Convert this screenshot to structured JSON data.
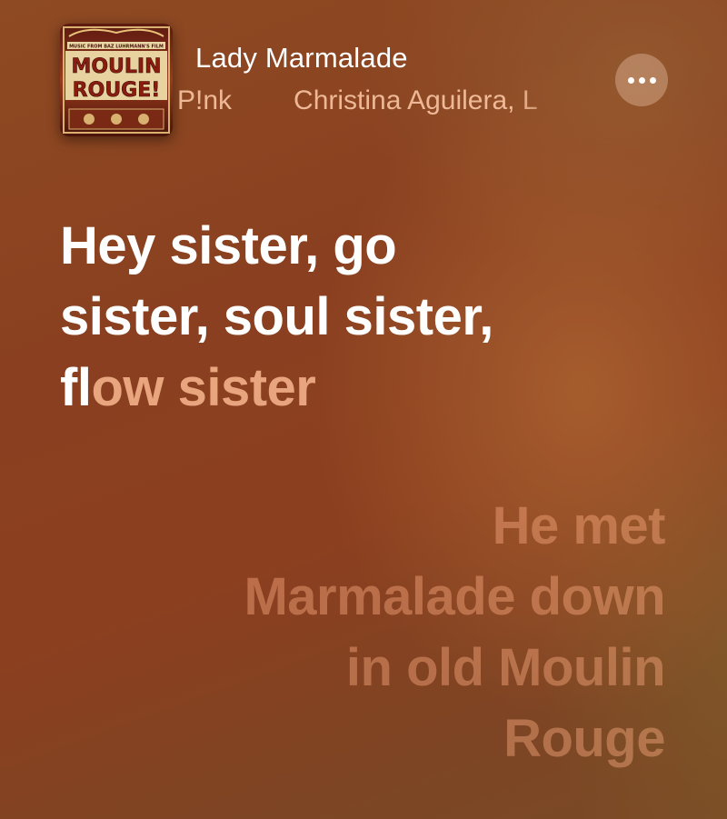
{
  "now_playing": {
    "title": "Lady Marmalade",
    "artists": [
      "P!nk",
      "Christina Aguilera, L"
    ],
    "album_art": {
      "label": "MUSIC FROM BAZ LUHRMANN'S FILM",
      "line1": "MOULIN",
      "line2": "ROUGE!"
    },
    "more_icon": "ellipsis-icon"
  },
  "lyrics": {
    "active": {
      "line1": "Hey sister, go",
      "line2": "sister, soul sister,",
      "line3_sung": "fl",
      "line3_pending": "ow sister"
    },
    "next": {
      "line1": "He met",
      "line2": "Marmalade down",
      "line3": "in old Moulin",
      "line4": "Rouge"
    }
  },
  "colors": {
    "background": "#8a4020",
    "active_text": "#ffffff",
    "inactive_text": "#ffaf82"
  }
}
